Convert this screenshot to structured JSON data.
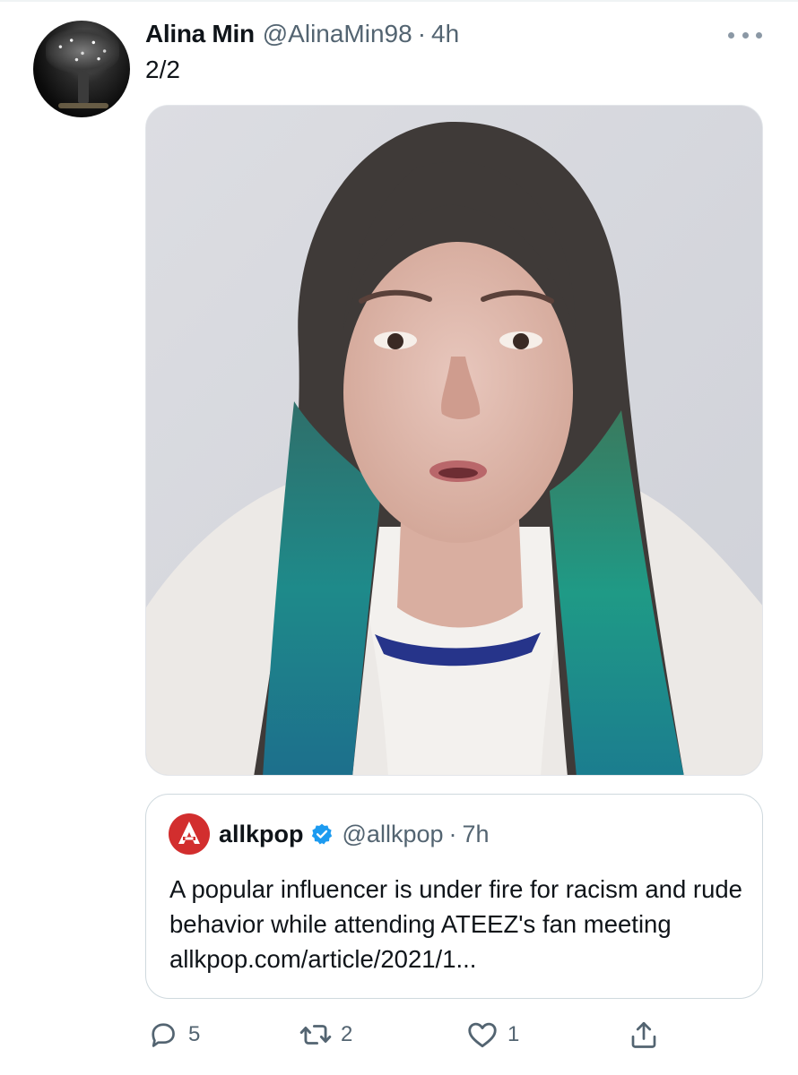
{
  "tweet": {
    "author": {
      "display_name": "Alina Min",
      "handle": "@AlinaMin98",
      "time": "4h",
      "separator": "·",
      "avatar_icon": "profile-photo-avatar"
    },
    "text": "2/2",
    "more_icon": "more-options-icon",
    "media": {
      "type": "video-still",
      "icon": "photo-person-teal-hair"
    },
    "quote": {
      "author": {
        "display_name": "allkpop",
        "handle": "@allkpop",
        "time": "7h",
        "separator": "·",
        "verified": true,
        "avatar_icon": "allkpop-logo",
        "avatar_color": "#d22e2e"
      },
      "text": "A popular influencer is under fire for racism and rude behavior while attending ATEEZ's fan meeting allkpop.com/article/2021/1..."
    },
    "actions": {
      "reply": {
        "icon": "reply-icon",
        "count": "5"
      },
      "retweet": {
        "icon": "retweet-icon",
        "count": "2"
      },
      "like": {
        "icon": "heart-icon",
        "count": "1"
      },
      "share": {
        "icon": "share-icon"
      }
    }
  },
  "colors": {
    "text_primary": "#0f1419",
    "text_secondary": "#536471",
    "verified_blue": "#1d9bf0",
    "border": "#cfd9de"
  }
}
